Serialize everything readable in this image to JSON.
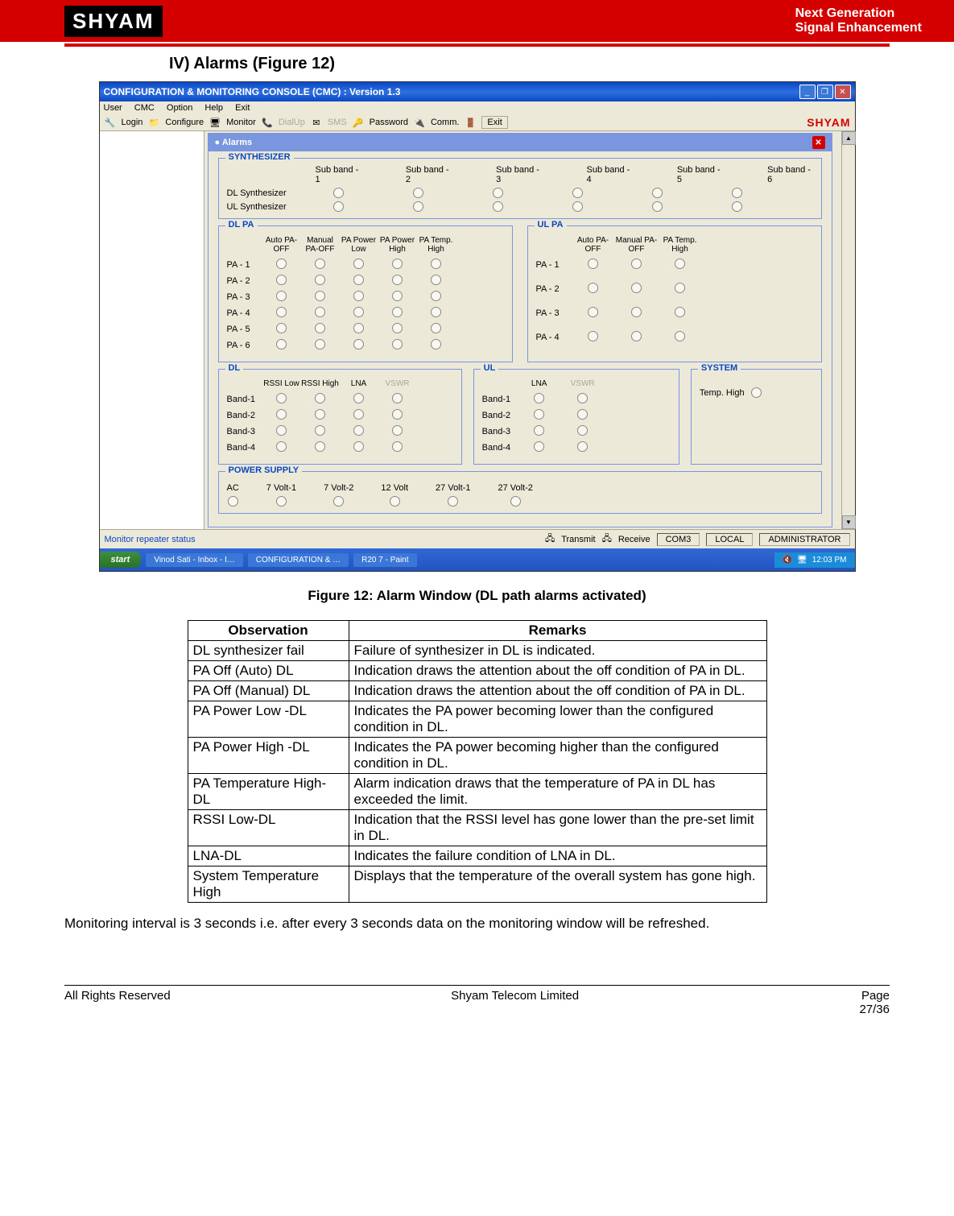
{
  "banner": {
    "logo": "SHYAM",
    "line1": "Next Generation",
    "line2": "Signal Enhancement"
  },
  "section_heading": "IV) Alarms (Figure 12)",
  "app": {
    "title": "CONFIGURATION & MONITORING CONSOLE (CMC)  :  Version 1.3",
    "menu": {
      "user": "User",
      "cmc": "CMC",
      "option": "Option",
      "help": "Help",
      "exit": "Exit"
    },
    "toolbar": {
      "login": "Login",
      "configure": "Configure",
      "monitor": "Monitor",
      "dialup": "DialUp",
      "sms": "SMS",
      "password": "Password",
      "comm": "Comm.",
      "exit": "Exit",
      "brand": "SHYAM"
    },
    "alarms_header": "Alarms",
    "synth": {
      "legend": "SYNTHESIZER",
      "cols": [
        "Sub band - 1",
        "Sub band - 2",
        "Sub band - 3",
        "Sub band - 4",
        "Sub band - 5",
        "Sub band - 6"
      ],
      "rows": [
        "DL Synthesizer",
        "UL Synthesizer"
      ]
    },
    "dlpa": {
      "legend": "DL PA",
      "cols": [
        "Auto PA-OFF",
        "Manual PA-OFF",
        "PA Power Low",
        "PA Power High",
        "PA Temp. High"
      ],
      "rows": [
        "PA - 1",
        "PA - 2",
        "PA - 3",
        "PA - 4",
        "PA - 5",
        "PA - 6"
      ]
    },
    "ulpa": {
      "legend": "UL PA",
      "cols": [
        "Auto PA-OFF",
        "Manual PA-OFF",
        "PA Temp. High"
      ],
      "rows": [
        "PA - 1",
        "PA - 2",
        "PA - 3",
        "PA - 4"
      ]
    },
    "dl": {
      "legend": "DL",
      "cols": [
        "RSSI Low",
        "RSSI High",
        "LNA",
        "VSWR"
      ],
      "rows": [
        "Band-1",
        "Band-2",
        "Band-3",
        "Band-4"
      ]
    },
    "ul": {
      "legend": "UL",
      "cols": [
        "LNA",
        "VSWR"
      ],
      "rows": [
        "Band-1",
        "Band-2",
        "Band-3",
        "Band-4"
      ]
    },
    "system": {
      "legend": "SYSTEM",
      "temp_high": "Temp. High"
    },
    "power": {
      "legend": "POWER SUPPLY",
      "items": [
        "AC",
        "7 Volt-1",
        "7 Volt-2",
        "12 Volt",
        "27 Volt-1",
        "27 Volt-2"
      ]
    },
    "status": {
      "left": "Monitor repeater status",
      "transmit": "Transmit",
      "receive": "Receive",
      "com": "COM3",
      "mode": "LOCAL",
      "role": "ADMINISTRATOR"
    },
    "taskbar": {
      "start": "start",
      "items": [
        "Vinod Sati - Inbox - I…",
        "CONFIGURATION & …",
        "R20 7 - Paint"
      ],
      "time": "12:03 PM"
    }
  },
  "figure_caption": "Figure 12: Alarm Window (DL path alarms activated)",
  "table": {
    "head": [
      "Observation",
      "Remarks"
    ],
    "rows": [
      [
        "DL synthesizer fail",
        "Failure of synthesizer in DL is indicated."
      ],
      [
        "PA Off (Auto) DL",
        "Indication draws the attention about the off condition of PA in DL."
      ],
      [
        "PA Off (Manual) DL",
        "Indication draws the attention about the off condition of PA in DL."
      ],
      [
        "PA Power Low -DL",
        "Indicates the PA power becoming lower than the configured condition in DL."
      ],
      [
        "PA Power High -DL",
        "Indicates the PA power becoming higher than the configured condition in DL."
      ],
      [
        "PA Temperature High-DL",
        "Alarm indication draws that the temperature of PA in DL has exceeded the limit."
      ],
      [
        "RSSI Low-DL",
        "Indication that the RSSI level has gone lower than the pre-set limit in DL."
      ],
      [
        "LNA-DL",
        "Indicates the failure condition of LNA in DL."
      ],
      [
        "System Temperature High",
        "Displays that the temperature of the overall system has gone high."
      ]
    ]
  },
  "paragraph": "Monitoring interval is 3 seconds i.e. after every 3 seconds data on the monitoring window will be refreshed.",
  "footer": {
    "left": "All Rights Reserved",
    "mid": "Shyam Telecom Limited",
    "right_top": "Page",
    "right_bot": "27/36"
  }
}
